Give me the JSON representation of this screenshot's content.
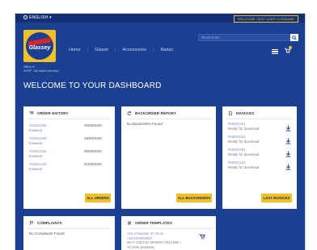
{
  "topbar": {
    "language": "ENGLISH",
    "welcome": "WELCOME TEST USER CUSNAME"
  },
  "brand": {
    "logo_text": "Glassey"
  },
  "nav": {
    "items": [
      "Home",
      "Glassit",
      "Accessories",
      "Badas"
    ]
  },
  "search": {
    "placeholder": "Ricerca per"
  },
  "breadcrumb": {
    "line1": "Ufficio di",
    "line2": "SHOP - Ma Inside Inventory"
  },
  "dashboard": {
    "title": "WELCOME TO YOUR DASHBOARD"
  },
  "order_history": {
    "title": "ORDER HISTORY",
    "rows": [
      {
        "id": "#01001505",
        "status": "Invoiced",
        "date": "25/09/2020"
      },
      {
        "id": "#01001490",
        "status": "Invoiced",
        "date": "19/09/2020"
      },
      {
        "id": "#01001465",
        "status": "Invoiced",
        "date": "08/09/2020"
      },
      {
        "id": "#01001228",
        "status": "Invoiced",
        "date": "01/09/2020"
      }
    ],
    "button": "ALL ORDERS"
  },
  "backorder": {
    "title": "BACKORDER REPORT",
    "empty": "No Backorders Found",
    "button": "ALL BACKORDERS"
  },
  "invoices": {
    "title": "INVOICES",
    "rows": [
      {
        "id": "#02002401",
        "status": "Ready for download"
      },
      {
        "id": "#02002022",
        "status": "Ready for download"
      },
      {
        "id": "#02002254",
        "status": "Ready for download"
      },
      {
        "id": "#02002153",
        "status": "Ready for download"
      }
    ],
    "button": "LAST INVOICES"
  },
  "complaints": {
    "title": "COMPLAINTS",
    "empty": "No Complaints Found"
  },
  "order_templates": {
    "title": "ORDER TEMPLATES",
    "line1": "cart schweitter 20 items -",
    "line2": "1920400500500",
    "line3": "55+A 140.0.5L MANGO YELLOW +",
    "line4": "70 more products"
  }
}
